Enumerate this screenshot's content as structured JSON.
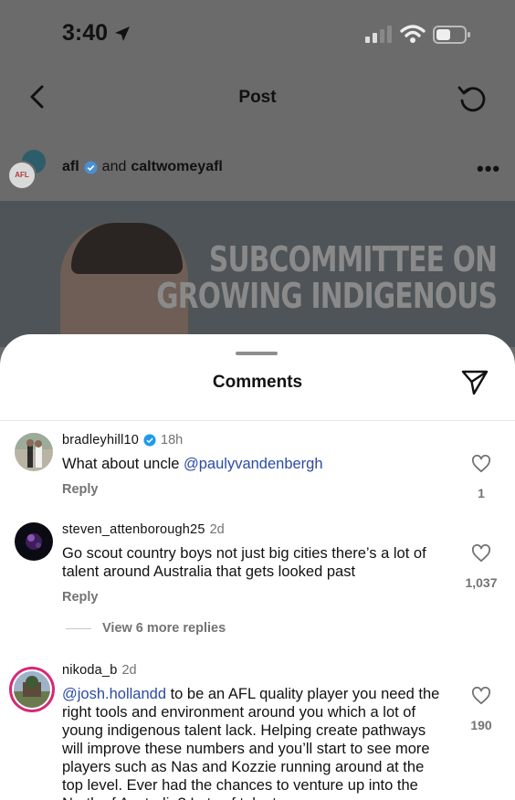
{
  "status_bar": {
    "time": "3:40"
  },
  "nav": {
    "title": "Post"
  },
  "post": {
    "users": {
      "primary": "afl",
      "connector": "and",
      "secondary": "caltwomeyafl"
    },
    "avatar_label": "AFL",
    "headline_lines": [
      "SUBCOMMITTEE ON",
      "GROWING INDIGENOUS"
    ]
  },
  "comments_sheet": {
    "title": "Comments",
    "comments": [
      {
        "username": "bradleyhill10",
        "verified": true,
        "time": "18h",
        "text_plain": "What about uncle ",
        "mention": "@paulyvandenbergh",
        "text_after": "",
        "reply_label": "Reply",
        "likes": "1"
      },
      {
        "username": "steven_attenborough25",
        "verified": false,
        "time": "2d",
        "text_plain": "Go scout country boys not just big cities there’s a lot of talent around Australia that gets looked past",
        "reply_label": "Reply",
        "likes": "1,037",
        "view_more": "View 6 more replies"
      },
      {
        "username": "nikoda_b",
        "verified": false,
        "time": "2d",
        "mention": "@josh.hollandd",
        "text_after": " to be an AFL quality player you need the right tools and environment around you which a lot of young indigenous talent lack. Helping create pathways will improve these numbers and you’ll start to see more players such as Nas and Kozzie running around at the top level. Ever had the chances to venture up into the North of Australia? Lots of talent",
        "likes": "190"
      }
    ]
  },
  "colors": {
    "mention": "#2b4aa6",
    "verified": "#1d9bf0",
    "story_ring": "#d62976"
  },
  "icons": [
    "location-arrow-icon",
    "signal-icon",
    "wifi-icon",
    "battery-icon",
    "back-chevron-icon",
    "refresh-icon",
    "verified-badge-icon",
    "more-icon",
    "share-icon",
    "heart-icon"
  ]
}
